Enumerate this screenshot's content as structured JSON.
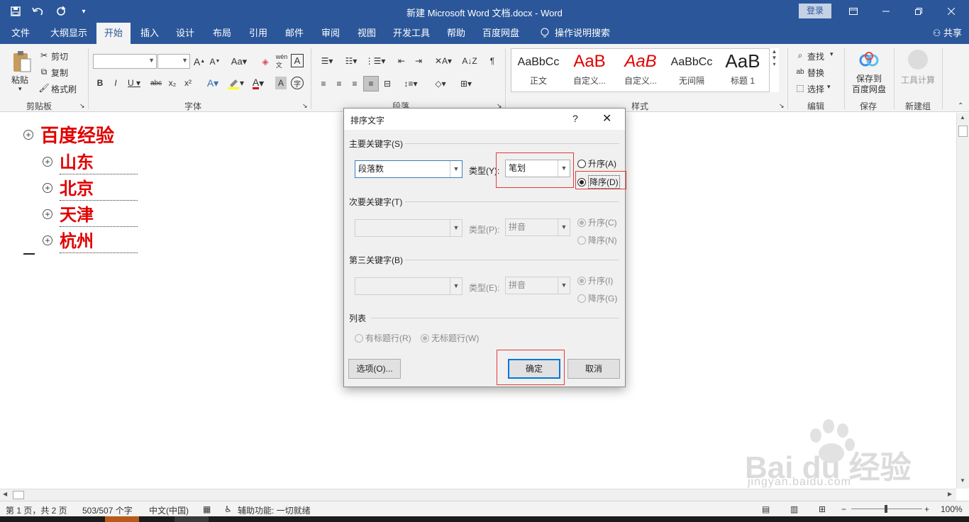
{
  "app": {
    "doc_title": "新建 Microsoft Word 文档.docx - Word",
    "login": "登录",
    "share": "共享"
  },
  "qat": {
    "save_icon": "save-icon",
    "undo_icon": "undo-icon",
    "redo_icon": "redo-icon",
    "customize_icon": "customize-icon"
  },
  "tabs": [
    "文件",
    "大纲显示",
    "开始",
    "插入",
    "设计",
    "布局",
    "引用",
    "邮件",
    "审阅",
    "视图",
    "开发工具",
    "帮助",
    "百度网盘",
    "操作说明搜索"
  ],
  "active_tab": "开始",
  "ribbon": {
    "clipboard": {
      "paste": "粘贴",
      "cut": "剪切",
      "copy": "复制",
      "format_painter": "格式刷",
      "label": "剪贴板"
    },
    "font": {
      "label": "字体",
      "font_name": "",
      "font_size": ""
    },
    "paragraph": {
      "label": "段落"
    },
    "styles": {
      "label": "样式",
      "items": [
        {
          "sample": "AaBbCc",
          "name": "正文"
        },
        {
          "sample": "AaB",
          "name": "自定义..."
        },
        {
          "sample": "AaB",
          "name": "自定义..."
        },
        {
          "sample": "AaBbCc",
          "name": "无间隔"
        },
        {
          "sample": "AaB",
          "name": "标题 1"
        }
      ]
    },
    "editing": {
      "find": "查找",
      "replace": "替换",
      "select": "选择",
      "label": "编辑"
    },
    "save": {
      "button": "保存到\n百度网盘",
      "label": "保存"
    },
    "newgroup": {
      "tool": "工具计算",
      "label": "新建组"
    }
  },
  "document": {
    "heading": "百度经验",
    "items": [
      "山东",
      "北京",
      "天津",
      "杭州"
    ]
  },
  "dialog": {
    "title": "排序文字",
    "help": "?",
    "primary_key_label": "主要关键字(S)",
    "primary_key_value": "段落数",
    "type_label_1": "类型(Y):",
    "type_value_1": "笔划",
    "asc_1": "升序(A)",
    "desc_1": "降序(D)",
    "order_1": "desc",
    "secondary_key_label": "次要关键字(T)",
    "secondary_key_value": "",
    "type_label_2": "类型(P):",
    "type_value_2": "拼音",
    "asc_2": "升序(C)",
    "desc_2": "降序(N)",
    "third_key_label": "第三关键字(B)",
    "third_key_value": "",
    "type_label_3": "类型(E):",
    "type_value_3": "拼音",
    "asc_3": "升序(I)",
    "desc_3": "降序(G)",
    "list_label": "列表",
    "has_header": "有标题行(R)",
    "no_header": "无标题行(W)",
    "options_button": "选项(O)...",
    "ok_button": "确定",
    "cancel_button": "取消"
  },
  "status": {
    "page": "第 1 页，共 2 页",
    "words": "503/507 个字",
    "language": "中文(中国)",
    "accessibility": "辅助功能: 一切就绪",
    "zoom": "100%"
  },
  "watermark": {
    "brand": "Bai du 经验",
    "url": "jingyan.baidu.com"
  }
}
